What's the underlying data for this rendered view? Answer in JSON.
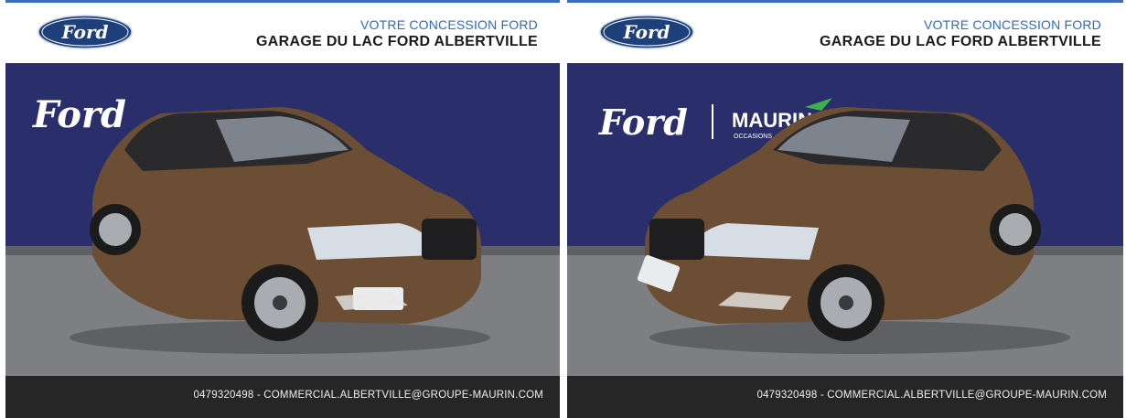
{
  "panels": [
    {
      "header": {
        "subtitle": "VOTRE CONCESSION FORD",
        "title": "GARAGE DU LAC FORD ALBERTVILLE"
      },
      "logo_text": "Ford",
      "backdrop_logo": "Ford",
      "footer": {
        "contact": "0479320498  - COMMERCIAL.ALBERTVILLE@GROUPE-MAURIN.COM"
      }
    },
    {
      "header": {
        "subtitle": "VOTRE CONCESSION FORD",
        "title": "GARAGE DU LAC FORD ALBERTVILLE"
      },
      "logo_text": "Ford",
      "backdrop_logo": "Ford",
      "backdrop_partner": "MAURIN",
      "backdrop_partner_sub": "OCCASIONS",
      "footer": {
        "contact": "0479320498  - COMMERCIAL.ALBERTVILLE@GROUPE-MAURIN.COM"
      }
    }
  ],
  "colors": {
    "ford_blue": "#1d3f7a",
    "header_accent": "#2c6bc0",
    "backdrop": "#2a2f6b",
    "car_body": "#6b4e34",
    "footer_bg": "#262626"
  },
  "icons": [
    "ford-logo-icon",
    "car-photo-icon"
  ]
}
